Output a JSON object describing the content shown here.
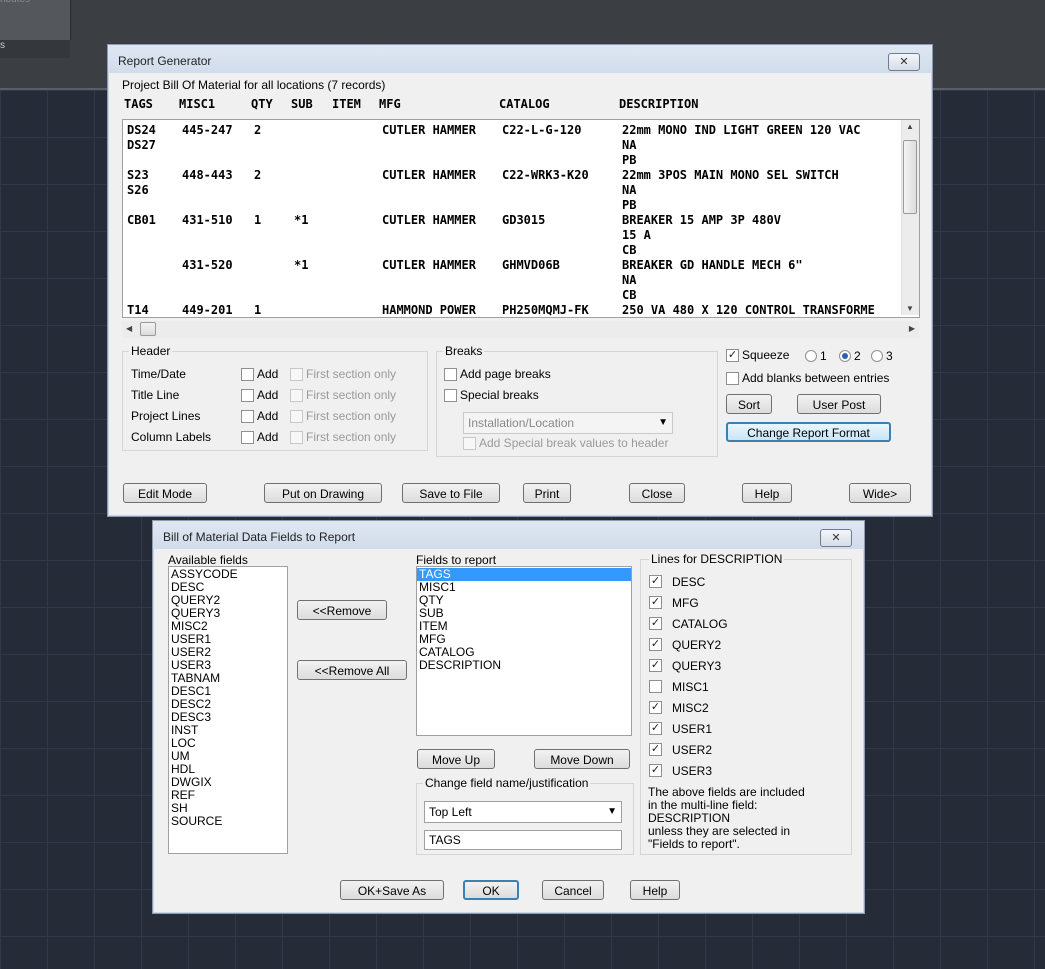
{
  "background": {
    "top_text": "ributes",
    "left_text": "s"
  },
  "report": {
    "title": "Report Generator",
    "summary": "Project Bill Of Material for all locations (7 records)",
    "columns": [
      "TAGS",
      "MISC1",
      "QTY",
      "SUB",
      "ITEM",
      "MFG",
      "CATALOG",
      "DESCRIPTION"
    ],
    "rows": [
      {
        "tags": "DS24",
        "misc1": "445-247",
        "qty": "2",
        "sub": "",
        "item": "",
        "mfg": "CUTLER HAMMER",
        "catalog": "C22-L-G-120",
        "desc": "22mm MONO IND LIGHT GREEN 120 VAC"
      },
      {
        "tags": "DS27",
        "misc1": "",
        "qty": "",
        "sub": "",
        "item": "",
        "mfg": "",
        "catalog": "",
        "desc": "NA"
      },
      {
        "tags": "",
        "misc1": "",
        "qty": "",
        "sub": "",
        "item": "",
        "mfg": "",
        "catalog": "",
        "desc": "PB"
      },
      {
        "tags": "S23",
        "misc1": "448-443",
        "qty": "2",
        "sub": "",
        "item": "",
        "mfg": "CUTLER HAMMER",
        "catalog": "C22-WRK3-K20",
        "desc": "22mm 3POS MAIN MONO SEL SWITCH"
      },
      {
        "tags": "S26",
        "misc1": "",
        "qty": "",
        "sub": "",
        "item": "",
        "mfg": "",
        "catalog": "",
        "desc": "NA"
      },
      {
        "tags": "",
        "misc1": "",
        "qty": "",
        "sub": "",
        "item": "",
        "mfg": "",
        "catalog": "",
        "desc": "PB"
      },
      {
        "tags": "CB01",
        "misc1": "431-510",
        "qty": "1",
        "sub": "*1",
        "item": "",
        "mfg": "CUTLER HAMMER",
        "catalog": "GD3015",
        "desc": "BREAKER 15 AMP 3P 480V"
      },
      {
        "tags": "",
        "misc1": "",
        "qty": "",
        "sub": "",
        "item": "",
        "mfg": "",
        "catalog": "",
        "desc": "15 A"
      },
      {
        "tags": "",
        "misc1": "",
        "qty": "",
        "sub": "",
        "item": "",
        "mfg": "",
        "catalog": "",
        "desc": "CB"
      },
      {
        "tags": "",
        "misc1": "431-520",
        "qty": "",
        "sub": "*1",
        "item": "",
        "mfg": "CUTLER HAMMER",
        "catalog": "GHMVD06B",
        "desc": "BREAKER GD HANDLE MECH 6\""
      },
      {
        "tags": "",
        "misc1": "",
        "qty": "",
        "sub": "",
        "item": "",
        "mfg": "",
        "catalog": "",
        "desc": "NA"
      },
      {
        "tags": "",
        "misc1": "",
        "qty": "",
        "sub": "",
        "item": "",
        "mfg": "",
        "catalog": "",
        "desc": "CB"
      },
      {
        "tags": "T14",
        "misc1": "449-201",
        "qty": "1",
        "sub": "",
        "item": "",
        "mfg": "HAMMOND POWER",
        "catalog": "PH250MQMJ-FK",
        "desc": "250 VA 480 X 120 CONTROL TRANSFORME"
      }
    ],
    "header_group": {
      "title": "Header",
      "add_label": "Add",
      "first_label": "First section only",
      "rows": [
        "Time/Date",
        "Title Line",
        "Project Lines",
        "Column Labels"
      ]
    },
    "breaks": {
      "title": "Breaks",
      "page_breaks": "Add page breaks",
      "special_breaks": "Special breaks",
      "combo_value": "Installation/Location",
      "add_special": "Add Special break values to header"
    },
    "options": {
      "squeeze": "Squeeze",
      "radio": [
        "1",
        "2",
        "3"
      ],
      "add_blanks": "Add blanks between entries",
      "sort": "Sort",
      "user_post": "User Post",
      "change_format": "Change Report Format"
    },
    "buttons": {
      "edit_mode": "Edit Mode",
      "put_on_drawing": "Put on Drawing",
      "save_to_file": "Save to File",
      "print": "Print",
      "close": "Close",
      "help": "Help",
      "wide": "Wide>"
    }
  },
  "bom": {
    "title": "Bill of Material Data Fields to Report",
    "available_label": "Available fields",
    "available": [
      "ASSYCODE",
      "DESC",
      "QUERY2",
      "QUERY3",
      "MISC2",
      "USER1",
      "USER2",
      "USER3",
      "TABNAM",
      "DESC1",
      "DESC2",
      "DESC3",
      "INST",
      "LOC",
      "UM",
      "HDL",
      "DWGIX",
      "REF",
      "SH",
      "SOURCE"
    ],
    "remove": "<<Remove",
    "remove_all": "<<Remove All",
    "report_label": "Fields to report",
    "report_fields": [
      "TAGS",
      "MISC1",
      "QTY",
      "SUB",
      "ITEM",
      "MFG",
      "CATALOG",
      "DESCRIPTION"
    ],
    "move_up": "Move Up",
    "move_down": "Move Down",
    "change_label": "Change field name/justification",
    "justification": "Top Left",
    "field_name": "TAGS",
    "lines_label": "Lines for DESCRIPTION",
    "lines": [
      {
        "name": "DESC",
        "checked": true
      },
      {
        "name": "MFG",
        "checked": true
      },
      {
        "name": "CATALOG",
        "checked": true
      },
      {
        "name": "QUERY2",
        "checked": true
      },
      {
        "name": "QUERY3",
        "checked": true
      },
      {
        "name": "MISC1",
        "checked": false
      },
      {
        "name": "MISC2",
        "checked": true
      },
      {
        "name": "USER1",
        "checked": true
      },
      {
        "name": "USER2",
        "checked": true
      },
      {
        "name": "USER3",
        "checked": true
      }
    ],
    "note": [
      "The above fields are included",
      "in the multi-line field:",
      "DESCRIPTION",
      "unless they are selected in",
      "\"Fields to report\"."
    ],
    "ok_save": "OK+Save As",
    "ok": "OK",
    "cancel": "Cancel",
    "help": "Help"
  }
}
